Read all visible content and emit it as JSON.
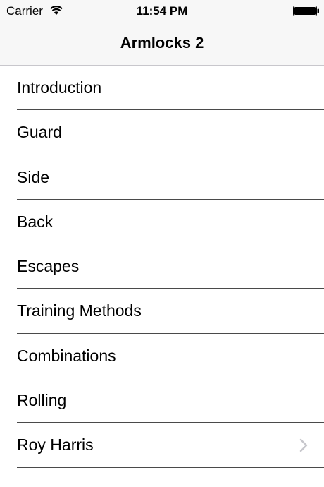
{
  "status_bar": {
    "carrier": "Carrier",
    "time": "11:54 PM",
    "wifi_icon": "wifi-icon",
    "battery_icon": "battery-icon"
  },
  "nav": {
    "title": "Armlocks 2"
  },
  "list": {
    "items": [
      {
        "label": "Introduction",
        "has_chevron": false
      },
      {
        "label": "Guard",
        "has_chevron": false
      },
      {
        "label": "Side",
        "has_chevron": false
      },
      {
        "label": "Back",
        "has_chevron": false
      },
      {
        "label": "Escapes",
        "has_chevron": false
      },
      {
        "label": "Training Methods",
        "has_chevron": false
      },
      {
        "label": "Combinations",
        "has_chevron": false
      },
      {
        "label": "Rolling",
        "has_chevron": false
      },
      {
        "label": "Roy Harris",
        "has_chevron": true,
        "chevron_icon": "chevron-right-icon"
      }
    ]
  },
  "colors": {
    "bar_background": "#f7f7f7",
    "separator": "#4a4a4a",
    "chevron": "#c7c7cc"
  }
}
